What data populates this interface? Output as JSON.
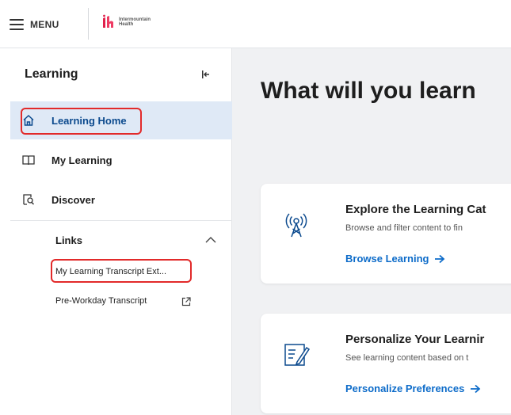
{
  "topbar": {
    "menu_label": "MENU",
    "logo_line1": "Intermountain",
    "logo_line2": "Health"
  },
  "sidebar": {
    "title": "Learning",
    "items": [
      {
        "label": "Learning Home",
        "icon": "home-icon",
        "active": true
      },
      {
        "label": "My Learning",
        "icon": "book-icon",
        "active": false
      },
      {
        "label": "Discover",
        "icon": "discover-icon",
        "active": false
      }
    ],
    "links": {
      "heading": "Links",
      "items": [
        {
          "label": "My Learning Transcript Ext..."
        },
        {
          "label": "Pre-Workday Transcript",
          "icon": "external-link-icon"
        }
      ]
    }
  },
  "main": {
    "heading": "What will you learn",
    "cards": [
      {
        "title": "Explore the Learning Cat",
        "description": "Browse and filter content to fin",
        "link": "Browse Learning",
        "icon": "broadcast-tower-icon"
      },
      {
        "title": "Personalize Your Learnir",
        "description": "See learning content based on t",
        "link": "Personalize Preferences",
        "icon": "edit-document-icon"
      }
    ]
  },
  "colors": {
    "accent": "#0c6bc9",
    "active_bg": "#dfe9f6",
    "highlight": "#e22a2a",
    "page_bg": "#f0f1f3"
  }
}
